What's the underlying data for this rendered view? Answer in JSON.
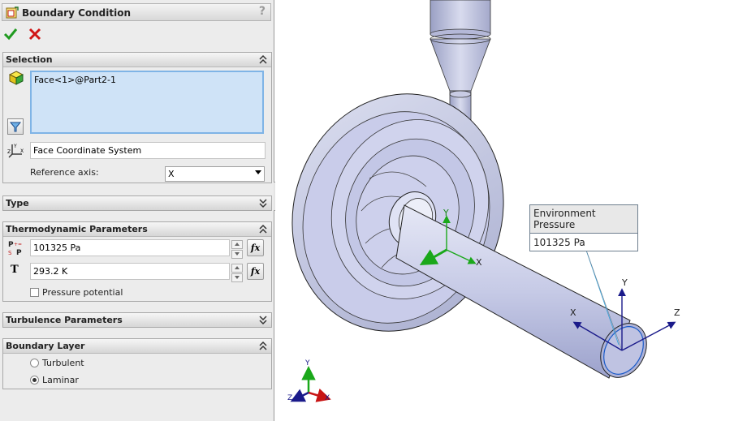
{
  "panel": {
    "title": "Boundary Condition",
    "help_label": "?",
    "selection": {
      "header": "Selection",
      "face_item": "Face<1>@Part2-1",
      "coordinate_system": "Face Coordinate System",
      "reference_axis_label": "Reference axis:",
      "reference_axis_value": "X"
    },
    "type": {
      "header": "Type"
    },
    "thermo": {
      "header": "Thermodynamic Parameters",
      "pressure_value": "101325 Pa",
      "temperature_symbol": "T",
      "temperature_value": "293.2 K",
      "fx_label": "fx",
      "pressure_potential_label": "Pressure potential"
    },
    "turbulence": {
      "header": "Turbulence Parameters"
    },
    "boundary_layer": {
      "header": "Boundary Layer",
      "options": [
        "Turbulent",
        "Laminar"
      ],
      "selected": "Laminar"
    }
  },
  "viewport": {
    "callout": {
      "title": "Environment Pressure",
      "value": "101325 Pa"
    },
    "local_axes": {
      "x": "X",
      "y": "Y",
      "z": "Z"
    },
    "mid_axes": {
      "x": "X",
      "y": "Y"
    },
    "triad": {
      "x": "X",
      "y": "Y",
      "z": "Z"
    }
  },
  "colors": {
    "accept": "#1f9a1f",
    "cancel": "#d01414",
    "selection_fill": "#cfe3f7",
    "selection_border": "#7fb4e6",
    "model_fill": "#c4c8e6",
    "axis_blue": "#1a1a8a",
    "axis_green": "#1aa81a",
    "axis_red": "#c81414"
  }
}
